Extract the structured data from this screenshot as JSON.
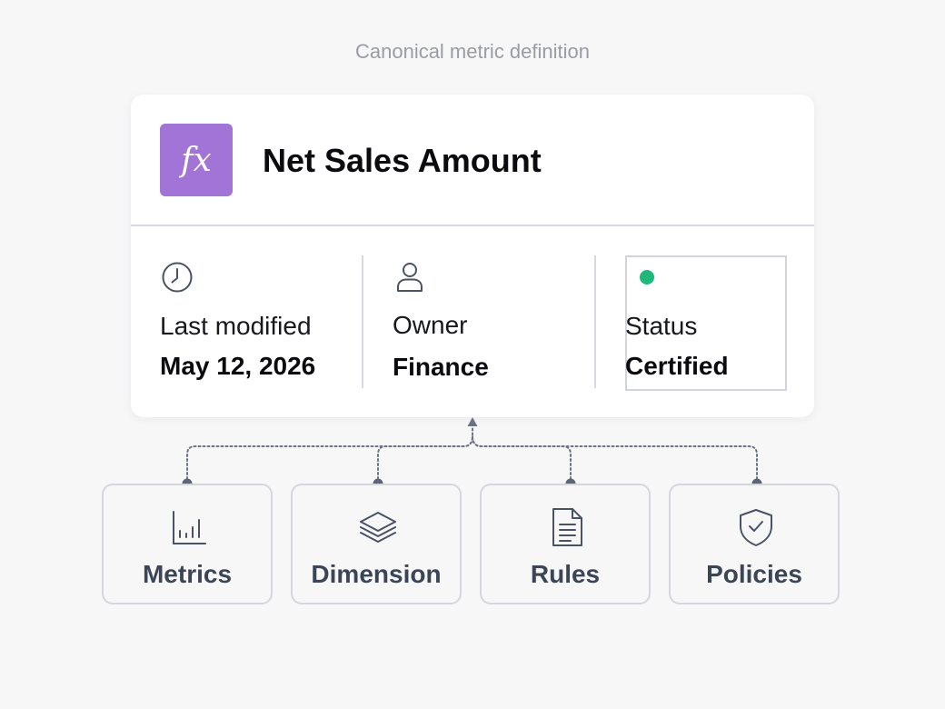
{
  "header": {
    "subtitle": "Canonical metric definition"
  },
  "metric": {
    "badge_text": "fx",
    "badge_icon": "function-icon",
    "badge_color": "#a274d8",
    "name": "Net Sales Amount"
  },
  "details": {
    "last_modified": {
      "icon": "clock-icon",
      "label": "Last modified",
      "value": "May 12, 2026"
    },
    "owner": {
      "icon": "user-icon",
      "label": "Owner",
      "value": "Finance"
    },
    "status": {
      "indicator_color": "#1fb87a",
      "label": "Status",
      "value": "Certified"
    }
  },
  "components": [
    {
      "icon": "bar-chart-icon",
      "label": "Metrics"
    },
    {
      "icon": "layers-icon",
      "label": "Dimension"
    },
    {
      "icon": "document-icon",
      "label": "Rules"
    },
    {
      "icon": "shield-check-icon",
      "label": "Policies"
    }
  ],
  "colors": {
    "connector": "#6b7385",
    "icon_stroke": "#4a5264",
    "component_label": "#3b4556"
  }
}
